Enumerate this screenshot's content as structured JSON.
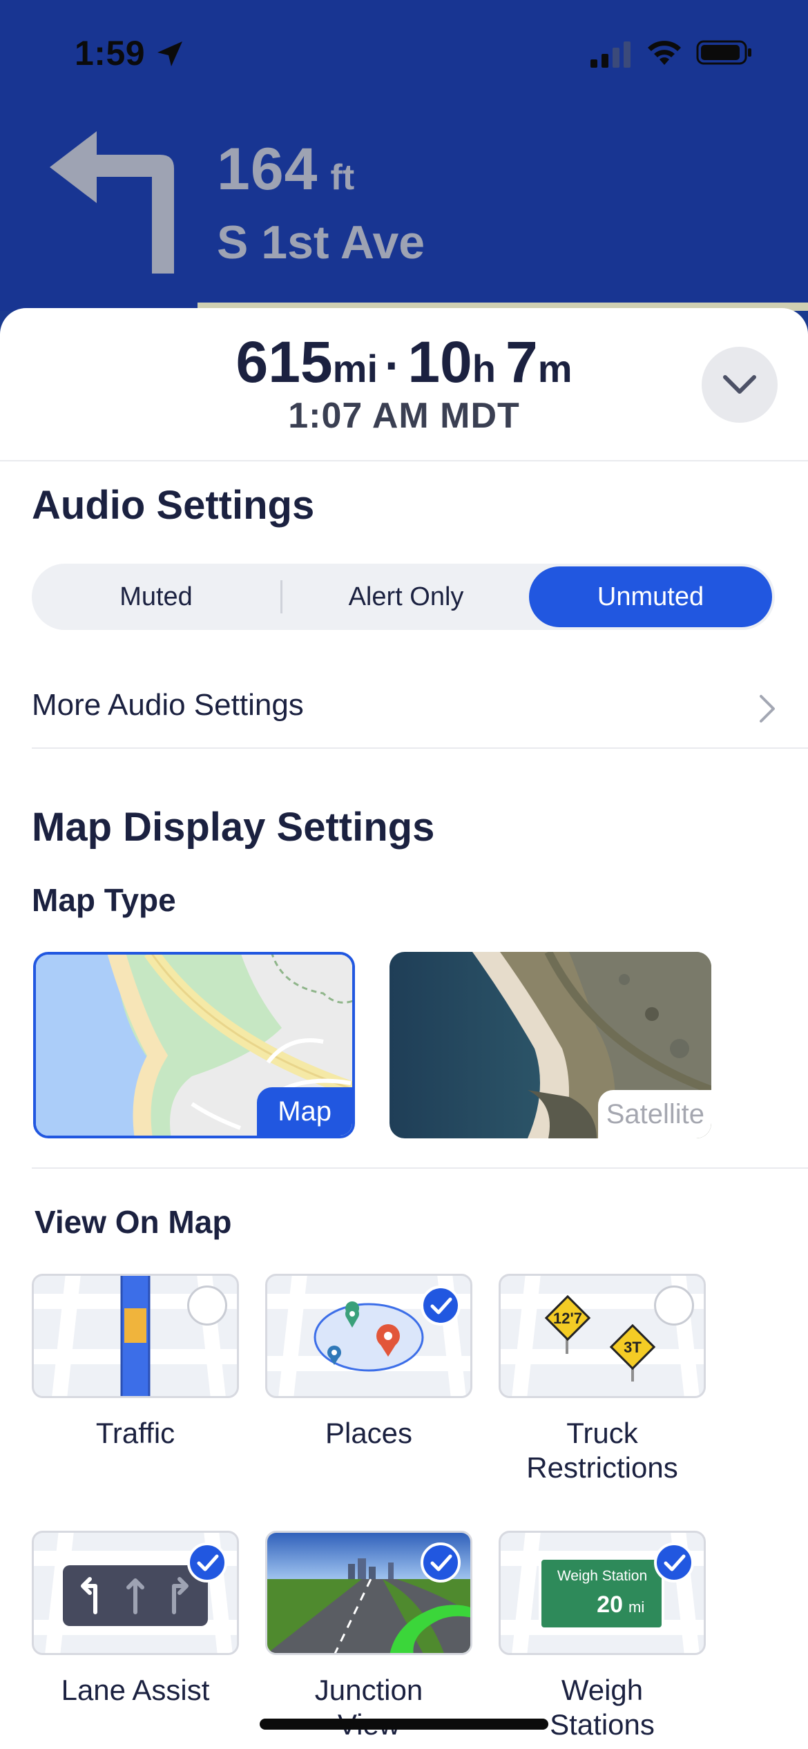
{
  "status_bar": {
    "time": "1:59"
  },
  "maneuver": {
    "distance_value": "164",
    "distance_unit": "ft",
    "street": "S 1st Ave"
  },
  "trip": {
    "miles": "615",
    "miles_unit": "mi",
    "separator": "·",
    "hours": "10",
    "hours_unit": "h",
    "minutes": "7",
    "minutes_unit": "m",
    "eta": "1:07 AM MDT"
  },
  "audio": {
    "title": "Audio Settings",
    "options": [
      "Muted",
      "Alert Only",
      "Unmuted"
    ],
    "selected": "Unmuted",
    "more_label": "More Audio Settings"
  },
  "map_display": {
    "title": "Map Display Settings",
    "map_type_label": "Map Type",
    "map_types": [
      {
        "label": "Map",
        "selected": true
      },
      {
        "label": "Satellite",
        "selected": false
      }
    ]
  },
  "view_on_map": {
    "title": "View On Map",
    "items": [
      {
        "label": "Traffic",
        "checked": false
      },
      {
        "label": "Places",
        "checked": true
      },
      {
        "label": "Truck Restrictions",
        "checked": false
      },
      {
        "label": "Lane Assist",
        "checked": true
      },
      {
        "label": "Junction View",
        "checked": true
      },
      {
        "label": "Weigh Stations",
        "checked": true
      }
    ],
    "truck_sign_height": "12'7",
    "truck_sign_weight": "3T",
    "weigh_sign_title": "Weigh Station",
    "weigh_sign_value": "20",
    "weigh_sign_unit": "mi"
  },
  "colors": {
    "header": "#183592",
    "accent": "#2157e0",
    "text": "#1b2140"
  }
}
